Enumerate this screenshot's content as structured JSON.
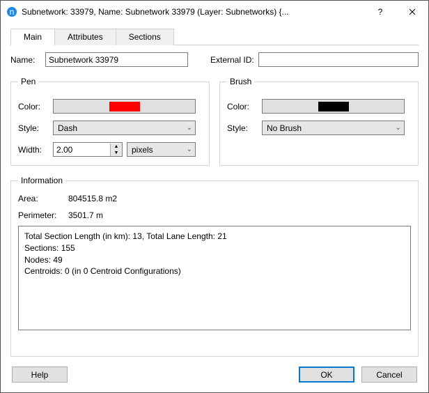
{
  "window": {
    "title": "Subnetwork: 33979, Name: Subnetwork 33979 (Layer: Subnetworks) {..."
  },
  "tabs": {
    "main": "Main",
    "attributes": "Attributes",
    "sections": "Sections"
  },
  "fields": {
    "name_label": "Name:",
    "name_value": "Subnetwork 33979",
    "extid_label": "External ID:",
    "extid_value": ""
  },
  "pen": {
    "legend": "Pen",
    "color_label": "Color:",
    "color": "#ff0000",
    "style_label": "Style:",
    "style_value": "Dash",
    "width_label": "Width:",
    "width_value": "2.00",
    "width_units": "pixels"
  },
  "brush": {
    "legend": "Brush",
    "color_label": "Color:",
    "color": "#000000",
    "style_label": "Style:",
    "style_value": "No Brush"
  },
  "info": {
    "legend": "Information",
    "area_label": "Area:",
    "area_value": "804515.8 m2",
    "perimeter_label": "Perimeter:",
    "perimeter_value": "3501.7 m",
    "details": "Total Section Length (in km): 13, Total Lane Length: 21\nSections: 155\nNodes: 49\nCentroids: 0 (in 0 Centroid Configurations)"
  },
  "buttons": {
    "help": "Help",
    "ok": "OK",
    "cancel": "Cancel"
  }
}
